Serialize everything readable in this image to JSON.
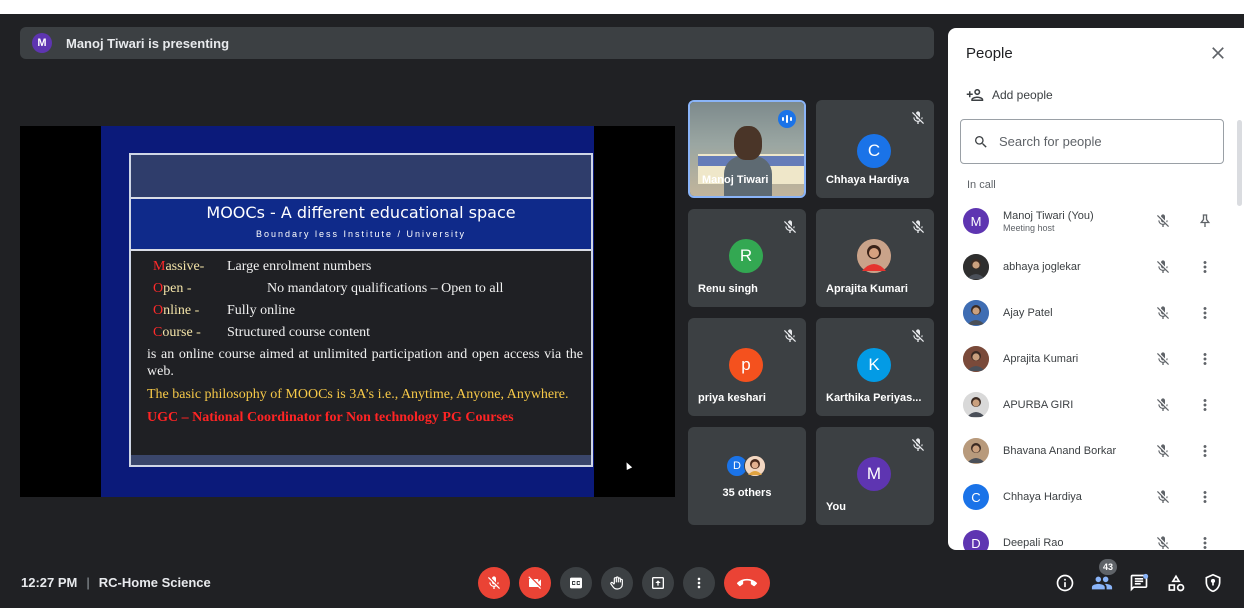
{
  "presenting_bar": {
    "avatar_letter": "M",
    "text": "Manoj Tiwari is presenting"
  },
  "slide": {
    "title": "MOOCs - A different educational space",
    "subtitle": "Boundary less Institute / University",
    "points": [
      {
        "initial": "M",
        "rest": "assive-",
        "text": "Large enrolment numbers"
      },
      {
        "initial": "O",
        "rest": "pen       -",
        "text": "No mandatory qualifications – Open to all"
      },
      {
        "initial": "O",
        "rest": "nline -",
        "text": "Fully online"
      },
      {
        "initial": "C",
        "rest": "ourse -",
        "text": "Structured course content"
      }
    ],
    "paragraph": "is an online course aimed at unlimited participation and open access via the web.",
    "philosophy": "The basic philosophy of MOOCs is 3A’s i.e., Anytime, Anyone, Anywhere.",
    "ugc": "UGC – National Coordinator for Non technology PG Courses"
  },
  "tiles": {
    "presenter": {
      "name": "Manoj Tiwari"
    },
    "chhaya": {
      "name": "Chhaya Hardiya",
      "letter": "C",
      "color": "#1a73e8"
    },
    "renu": {
      "name": "Renu singh",
      "letter": "R",
      "color": "#33a852"
    },
    "aprajita": {
      "name": "Aprajita Kumari"
    },
    "priya": {
      "name": "priya keshari",
      "letter": "p",
      "color": "#f4511e"
    },
    "karthika": {
      "name": "Karthika Periyas...",
      "letter": "K",
      "color": "#039be5"
    },
    "others": {
      "label": "35 others",
      "letter": "D",
      "color": "#1a73e8"
    },
    "you": {
      "name": "You",
      "letter": "M",
      "color": "#5e35b1"
    }
  },
  "people_panel": {
    "title": "People",
    "add_people": "Add people",
    "search_placeholder": "Search for people",
    "section": "In call",
    "people": [
      {
        "name": "Manoj Tiwari (You)",
        "sub": "Meeting host",
        "letter": "M",
        "color": "#5e35b1",
        "photo": false
      },
      {
        "name": "abhaya joglekar",
        "sub": "",
        "letter": "",
        "color": "#2e2e2e",
        "photo": true
      },
      {
        "name": "Ajay Patel",
        "sub": "",
        "letter": "",
        "color": "#3f6db3",
        "photo": true
      },
      {
        "name": "Aprajita Kumari",
        "sub": "",
        "letter": "",
        "color": "#7a4a3a",
        "photo": true
      },
      {
        "name": "APURBA GIRI",
        "sub": "",
        "letter": "",
        "color": "#d9d9d9",
        "photo": true
      },
      {
        "name": "Bhavana Anand Borkar",
        "sub": "",
        "letter": "",
        "color": "#b89a7c",
        "photo": true
      },
      {
        "name": "Chhaya Hardiya",
        "sub": "",
        "letter": "C",
        "color": "#1a73e8",
        "photo": false
      },
      {
        "name": "Deepali Rao",
        "sub": "",
        "letter": "D",
        "color": "#5e35b1",
        "photo": false
      }
    ]
  },
  "bottom_bar": {
    "time": "12:27 PM",
    "meeting_name": "RC-Home Science",
    "participants_count": "43"
  }
}
